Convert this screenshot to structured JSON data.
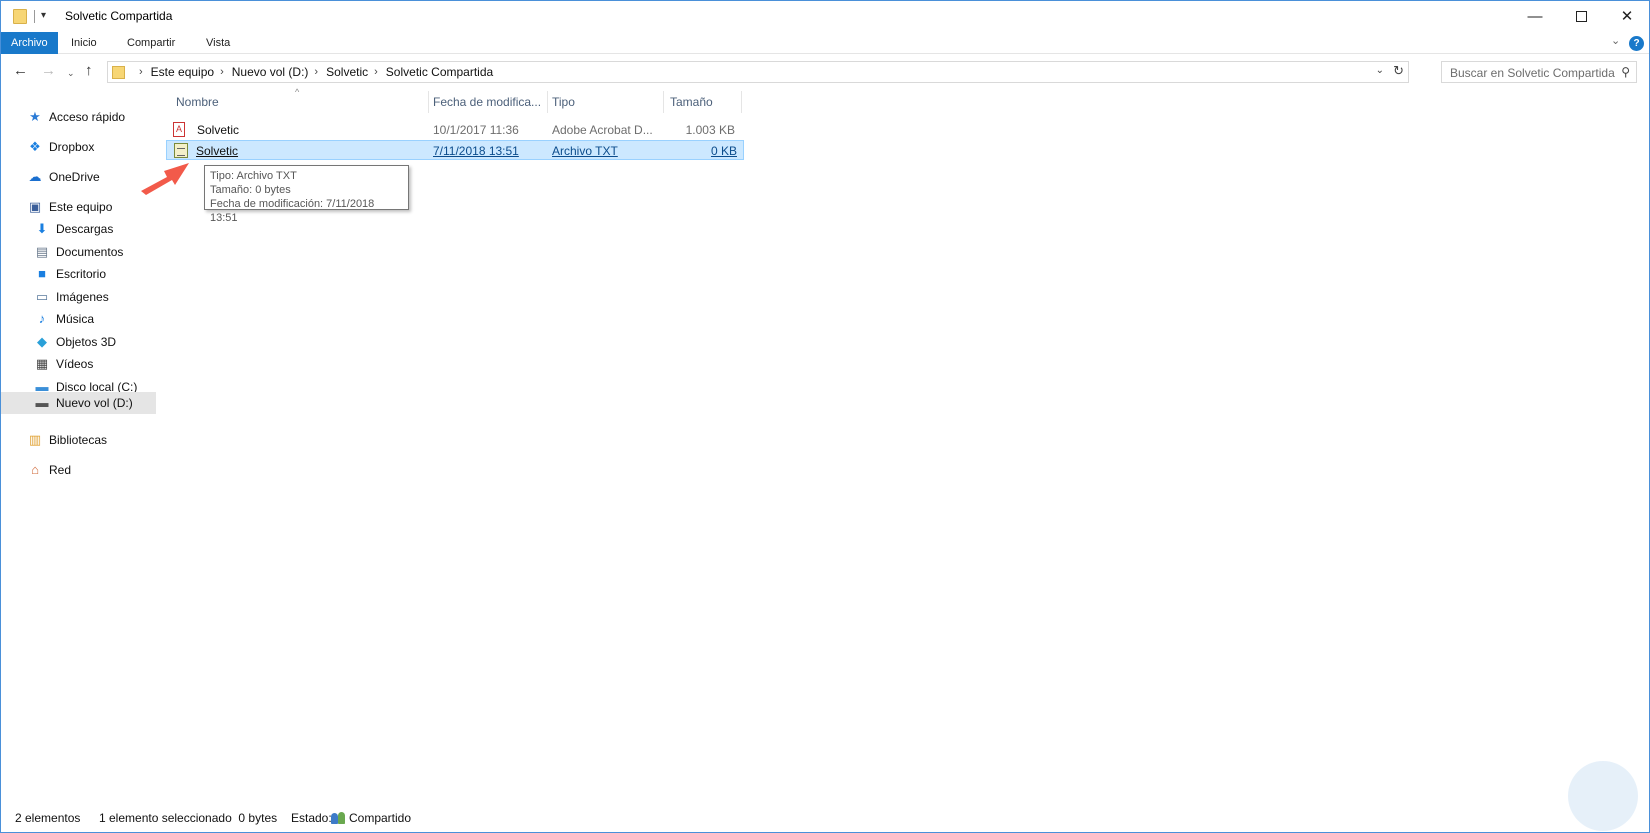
{
  "window": {
    "title": "Solvetic Compartida"
  },
  "ribbon": {
    "tabs": [
      "Archivo",
      "Inicio",
      "Compartir",
      "Vista"
    ]
  },
  "address_bar": {
    "crumbs": [
      "Este equipo",
      "Nuevo vol (D:)",
      "Solvetic",
      "Solvetic Compartida"
    ]
  },
  "search": {
    "placeholder": "Buscar en Solvetic Compartida"
  },
  "sidebar": {
    "items": [
      {
        "label": "Acceso rápido",
        "icon": "star-icon"
      },
      {
        "label": "Dropbox",
        "icon": "dropbox-icon"
      },
      {
        "label": "OneDrive",
        "icon": "cloud-icon"
      },
      {
        "label": "Este equipo",
        "icon": "computer-icon"
      },
      {
        "label": "Descargas",
        "icon": "download-icon"
      },
      {
        "label": "Documentos",
        "icon": "document-icon"
      },
      {
        "label": "Escritorio",
        "icon": "desktop-icon"
      },
      {
        "label": "Imágenes",
        "icon": "images-icon"
      },
      {
        "label": "Música",
        "icon": "music-icon"
      },
      {
        "label": "Objetos 3D",
        "icon": "cube-icon"
      },
      {
        "label": "Vídeos",
        "icon": "video-icon"
      },
      {
        "label": "Disco local (C:)",
        "icon": "drive-c-icon"
      },
      {
        "label": "Nuevo vol (D:)",
        "icon": "drive-d-icon"
      },
      {
        "label": "Bibliotecas",
        "icon": "library-icon"
      },
      {
        "label": "Red",
        "icon": "network-icon"
      }
    ]
  },
  "filelist": {
    "columns": [
      "Nombre",
      "Fecha de modifica...",
      "Tipo",
      "Tamaño"
    ],
    "rows": [
      {
        "name": "Solvetic",
        "date": "10/1/2017 11:36",
        "type": "Adobe Acrobat D...",
        "size": "1.003 KB",
        "icon": "pdf-icon"
      },
      {
        "name": "Solvetic",
        "date": "7/11/2018 13:51",
        "type": "Archivo TXT",
        "size": "0 KB",
        "icon": "txt-icon"
      }
    ]
  },
  "tooltip": {
    "line1": "Tipo: Archivo TXT",
    "line2": "Tamaño: 0 bytes",
    "line3": "Fecha de modificación: 7/11/2018 13:51"
  },
  "status": {
    "count": "2 elementos",
    "selected": "1 elemento seleccionado  0 bytes",
    "state_label": "Estado:",
    "state_value": "Compartido"
  }
}
